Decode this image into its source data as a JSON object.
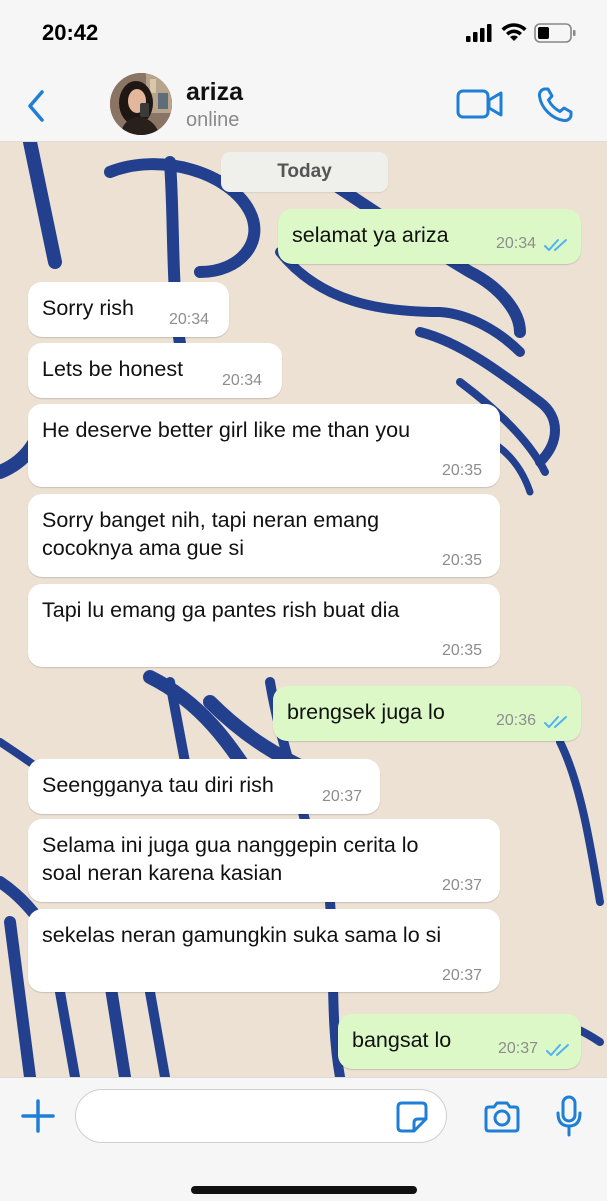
{
  "status_bar": {
    "time": "20:42"
  },
  "header": {
    "contact_name": "ariza",
    "contact_status": "online"
  },
  "date_divider": "Today",
  "messages": [
    {
      "dir": "out",
      "text": "selamat ya ariza",
      "time": "20:34",
      "read": true
    },
    {
      "dir": "in",
      "text": "Sorry rish",
      "time": "20:34"
    },
    {
      "dir": "in",
      "text": "Lets be honest",
      "time": "20:34"
    },
    {
      "dir": "in",
      "text": "He deserve better girl like me than you",
      "time": "20:35"
    },
    {
      "dir": "in",
      "text": "Sorry banget nih, tapi neran emang\ncocoknya ama gue si",
      "time": "20:35"
    },
    {
      "dir": "in",
      "text": "Tapi lu emang ga pantes rish buat dia",
      "time": "20:35"
    },
    {
      "dir": "out",
      "text": "brengsek juga lo",
      "time": "20:36",
      "read": true
    },
    {
      "dir": "in",
      "text": "Seengganya tau diri rish",
      "time": "20:37"
    },
    {
      "dir": "in",
      "text": "Selama ini juga gua nanggepin cerita lo\nsoal neran karena kasian",
      "time": "20:37"
    },
    {
      "dir": "in",
      "text": "sekelas neran gamungkin suka sama lo si",
      "time": "20:37"
    },
    {
      "dir": "out",
      "text": "bangsat lo",
      "time": "20:37",
      "read": true
    }
  ],
  "input": {
    "value": "",
    "placeholder": ""
  },
  "colors": {
    "accent": "#1f7ed6",
    "outgoing_bubble": "#dcf8c6",
    "incoming_bubble": "#ffffff",
    "read_ticks": "#4fb3f0",
    "wallpaper": "#ece1d3",
    "wallpaper_strokes": "#22408e"
  },
  "icons": [
    "back-chevron-icon",
    "video-call-icon",
    "phone-icon",
    "plus-icon",
    "sticker-icon",
    "camera-icon",
    "microphone-icon",
    "double-check-icon"
  ]
}
